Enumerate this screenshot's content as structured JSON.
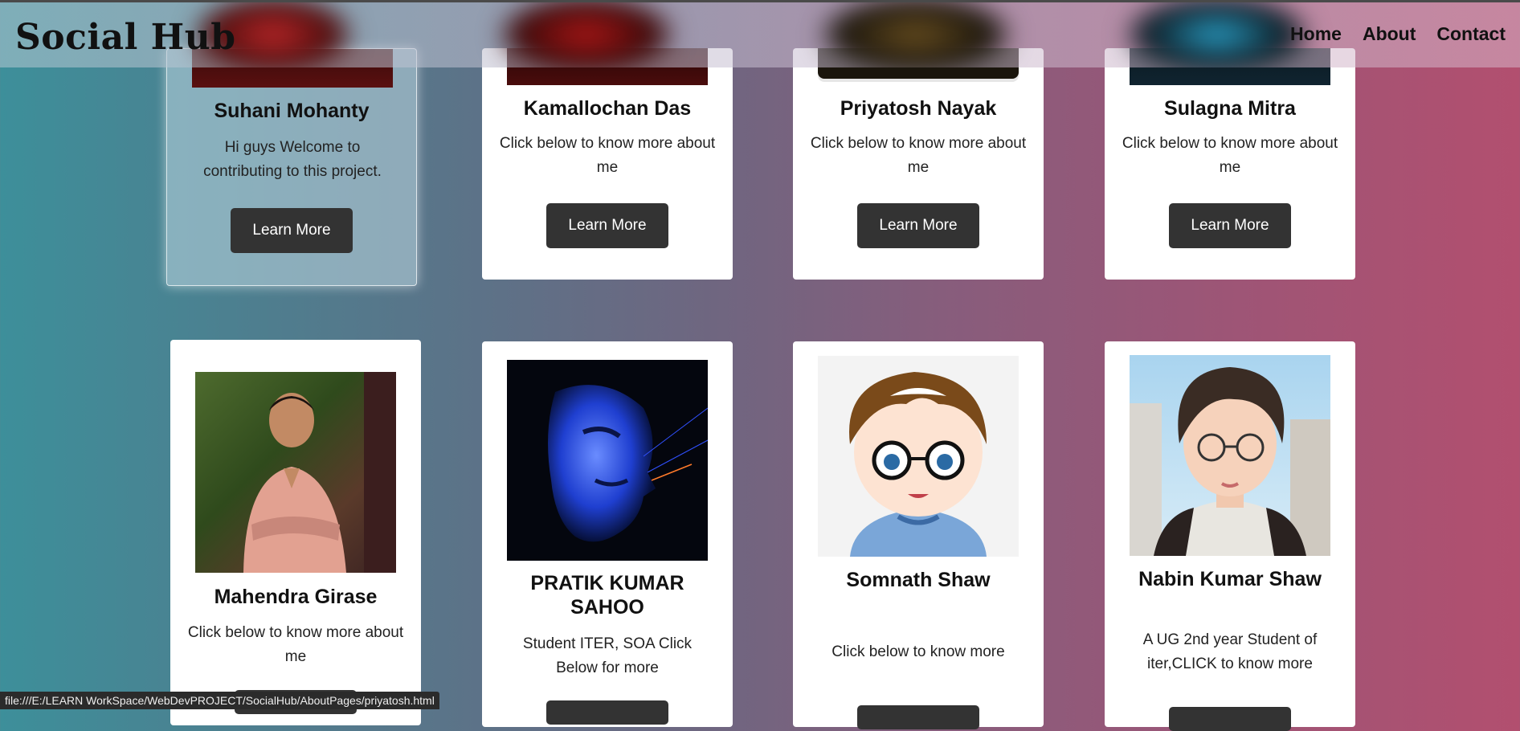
{
  "header": {
    "logo": "Social Hub",
    "nav": [
      "Home",
      "About",
      "Contact"
    ]
  },
  "cards_top": [
    {
      "name": "Suhani Mohanty",
      "desc": "Hi guys Welcome to contributing to this project.",
      "button": "Learn More"
    },
    {
      "name": "Kamallochan Das",
      "desc": "Click below to know more about me",
      "button": "Learn More"
    },
    {
      "name": "Priyatosh Nayak",
      "desc": "Click below to know more about me",
      "button": "Learn More"
    },
    {
      "name": "Sulagna Mitra",
      "desc": "Click below to know more about me",
      "button": "Learn More"
    }
  ],
  "cards_bottom": [
    {
      "name": "Mahendra Girase",
      "desc": "Click below to know more about me"
    },
    {
      "name": "PRATIK KUMAR SAHOO",
      "desc": "Student ITER, SOA Click Below for more"
    },
    {
      "name": "Somnath Shaw",
      "desc": "Click below to know more"
    },
    {
      "name": "Nabin Kumar Shaw",
      "desc": "A UG 2nd year Student of iter,CLICK to know more"
    }
  ],
  "status_url": "file:///E:/LEARN WorkSpace/WebDevPROJECT/SocialHub/AboutPages/priyatosh.html"
}
